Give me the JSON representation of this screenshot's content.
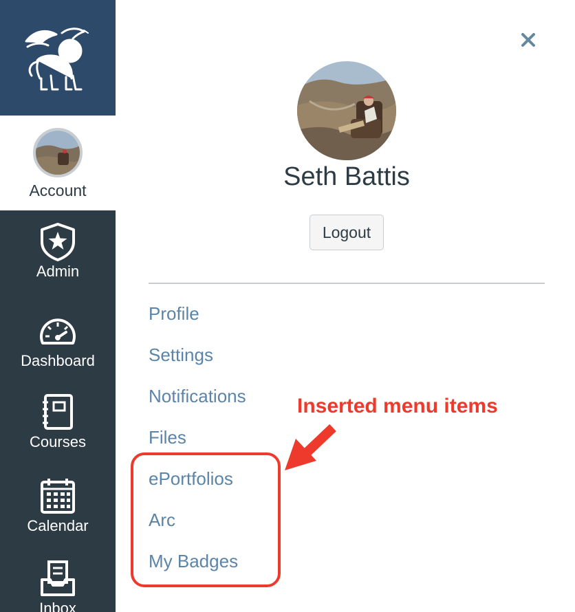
{
  "nav": {
    "account_label": "Account",
    "items": [
      {
        "label": "Admin",
        "icon": "shield-star-icon"
      },
      {
        "label": "Dashboard",
        "icon": "speedometer-icon"
      },
      {
        "label": "Courses",
        "icon": "notebook-icon"
      },
      {
        "label": "Calendar",
        "icon": "calendar-icon"
      },
      {
        "label": "Inbox",
        "icon": "inbox-icon"
      }
    ],
    "logo": "winged-lion-logo"
  },
  "tray": {
    "user_name": "Seth Battis",
    "logout_label": "Logout",
    "close_icon": "close-icon",
    "menu": [
      "Profile",
      "Settings",
      "Notifications",
      "Files",
      "ePortfolios",
      "Arc",
      "My Badges"
    ]
  },
  "annotation": {
    "label": "Inserted menu items"
  },
  "colors": {
    "nav_bg": "#2d3b45",
    "logo_bg": "#2d4a6b",
    "link": "#5b84a8",
    "annotation": "#ee3a2c"
  }
}
